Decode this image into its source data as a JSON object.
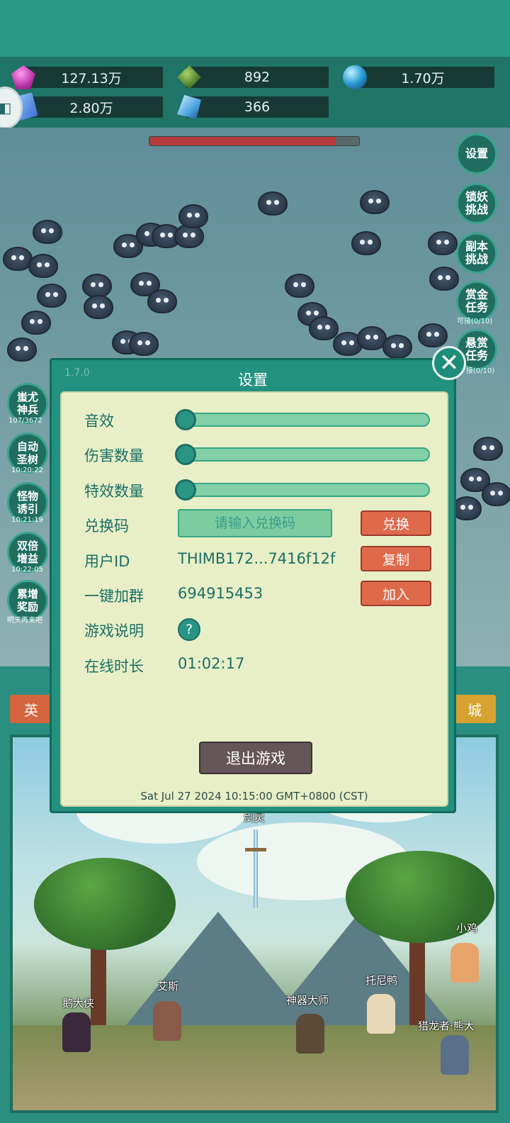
{
  "resources": {
    "gem": "127.13万",
    "green_gem": "892",
    "orb": "1.70万",
    "book": "2.80万",
    "crystal": "366"
  },
  "boss_health_fraction": 0.89,
  "side_buttons": {
    "settings": "设置",
    "lock_demon": "锁妖\n挑战",
    "dungeon": "副本\n挑战",
    "bounty_task": "赏金\n任务",
    "bounty_task_sub": "可接(0/10)",
    "reward_task": "悬赏\n任务",
    "reward_task_sub": "接(0/10)"
  },
  "left_buttons": [
    {
      "label": "蚩尤\n神兵",
      "sub": "107/3672"
    },
    {
      "label": "自动\n圣树",
      "sub": "10:20:22"
    },
    {
      "label": "怪物\n诱引",
      "sub": "10:21:19"
    },
    {
      "label": "双倍\n增益",
      "sub": "10:22:05"
    },
    {
      "label": "累增\n奖励",
      "sub": "明天再来吧"
    }
  ],
  "tabs": {
    "left": "英",
    "right": "城"
  },
  "npcs": {
    "sword": "剑灵",
    "duck_hero": "鹅大侠",
    "ace": "艾斯",
    "master": "神器大师",
    "tony": "托尼鸭",
    "chick": "小鸡",
    "bear": "猎龙者·熊大"
  },
  "modal": {
    "version": "1.7.0",
    "title": "设置",
    "close_icon": "close-icon",
    "rows": {
      "sound": "音效",
      "damage": "伤害数量",
      "effects": "特效数量",
      "redeem": "兑换码",
      "user_id": "用户ID",
      "join_group": "一键加群",
      "instructions": "游戏说明",
      "online_time": "在线时长"
    },
    "sliders": {
      "sound": 0,
      "damage": 0,
      "effects": 0
    },
    "redeem_placeholder": "请输入兑换码",
    "redeem_button": "兑换",
    "user_id_value": "THIMB172...7416f12f",
    "copy_button": "复制",
    "group_value": "694915453",
    "join_button": "加入",
    "help_symbol": "?",
    "online_value": "01:02:17",
    "exit_button": "退出游戏",
    "timestamp": "Sat Jul 27 2024 10:15:00 GMT+0800 (CST)"
  },
  "colors": {
    "accent_teal": "#23917f",
    "panel_bg": "#e8efc7",
    "red_button": "#df6a4b",
    "exit_button": "#655657"
  }
}
